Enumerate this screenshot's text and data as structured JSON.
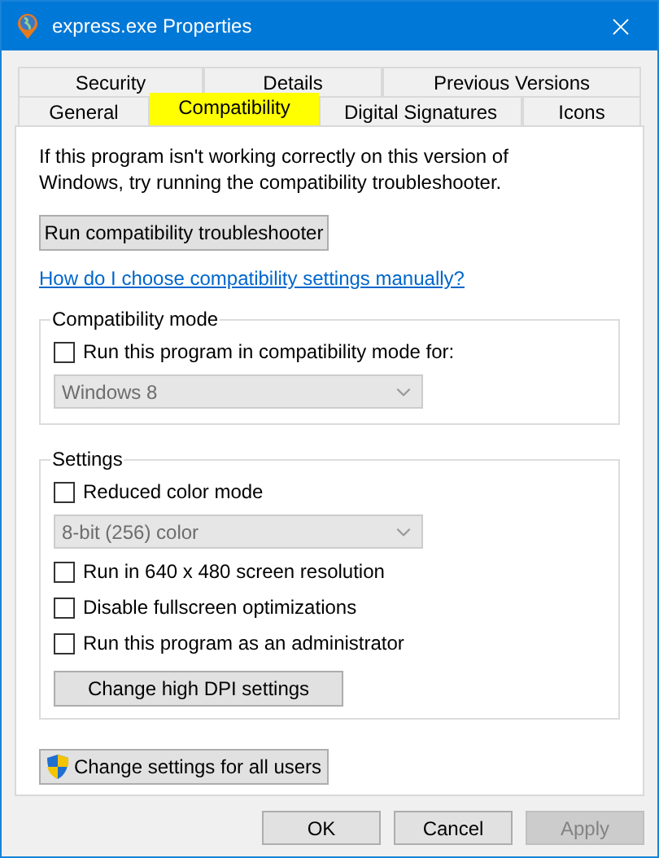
{
  "window": {
    "title": "express.exe Properties"
  },
  "tab_rows": [
    {
      "tabs": [
        {
          "label": "Security",
          "selected": false
        },
        {
          "label": "Details",
          "selected": false
        },
        {
          "label": "Previous Versions",
          "selected": false
        }
      ]
    },
    {
      "tabs": [
        {
          "label": "General",
          "selected": false
        },
        {
          "label": "Compatibility",
          "selected": true
        },
        {
          "label": "Digital Signatures",
          "selected": false
        },
        {
          "label": "Icons",
          "selected": false
        }
      ]
    }
  ],
  "intro": "If this program isn't working correctly on this version of Windows, try running the compatibility troubleshooter.",
  "troubleshooter_button": "Run compatibility troubleshooter",
  "help_link": "How do I choose compatibility settings manually?",
  "groups": [
    {
      "title": "Compatibility mode",
      "items": [
        {
          "kind": "checkbox",
          "label": "Run this program in compatibility mode for:",
          "checked": false
        },
        {
          "kind": "dropdown",
          "value": "Windows 8",
          "disabled": true
        }
      ]
    },
    {
      "title": "Settings",
      "items": [
        {
          "kind": "checkbox",
          "label": "Reduced color mode",
          "checked": false
        },
        {
          "kind": "dropdown",
          "value": "8-bit (256) color",
          "disabled": true
        },
        {
          "kind": "checkbox",
          "label": "Run in 640 x 480 screen resolution",
          "checked": false
        },
        {
          "kind": "checkbox",
          "label": "Disable fullscreen optimizations",
          "checked": false
        },
        {
          "kind": "checkbox",
          "label": "Run this program as an administrator",
          "checked": false
        },
        {
          "kind": "button",
          "label": "Change high DPI settings"
        }
      ]
    }
  ],
  "all_users_button": "Change settings for all users",
  "buttons": [
    {
      "label": "OK",
      "disabled": false
    },
    {
      "label": "Cancel",
      "disabled": false
    },
    {
      "label": "Apply",
      "disabled": true
    }
  ]
}
